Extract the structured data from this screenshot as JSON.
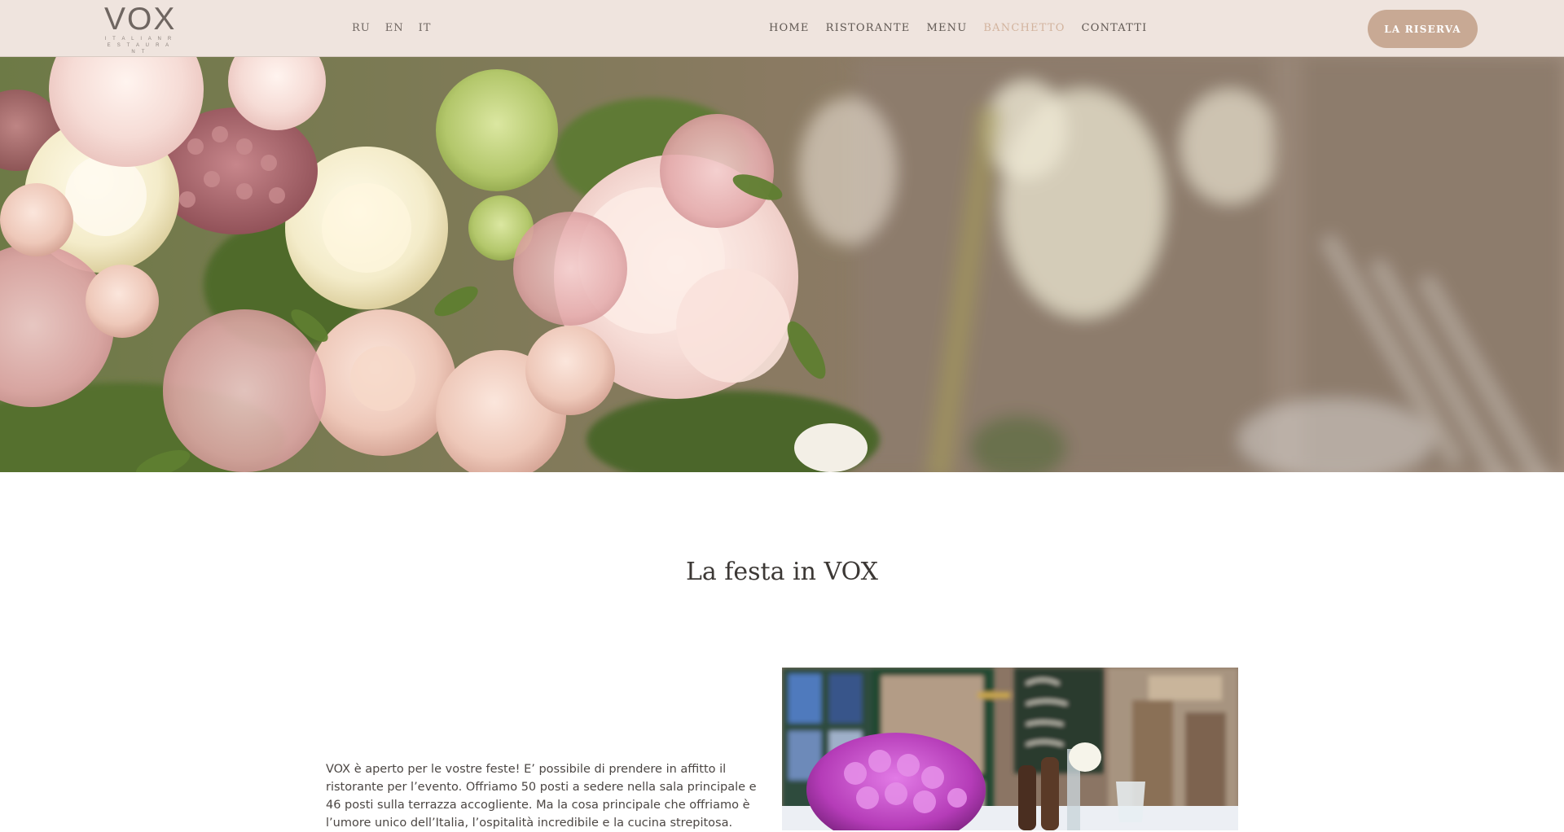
{
  "brand": {
    "logo_main": "VOX",
    "logo_sub": "I T A L I A N   R E S T A U R A N T"
  },
  "languages": [
    "RU",
    "EN",
    "IT"
  ],
  "nav": {
    "items": [
      {
        "label": "HOME",
        "active": false
      },
      {
        "label": "RISTORANTE",
        "active": false
      },
      {
        "label": "MENU",
        "active": false
      },
      {
        "label": "BANCHETTO",
        "active": true
      },
      {
        "label": "CONTATTI",
        "active": false
      }
    ]
  },
  "header": {
    "reserve_label": "LA RISERVA"
  },
  "content": {
    "title": "La festa in VOX",
    "intro": "VOX è aperto per le vostre feste! E’ possibile di prendere in affitto il ristorante per l’evento. Offriamo 50 posti a sedere nella sala principale e 46 posti sulla terrazza accogliente. Ma la cosa principale che offriamo è l’umore unico dell’Italia, l’ospitalità incredibile e la cucina strepitosa."
  },
  "colors": {
    "header_bg": "#efe4de",
    "accent": "#c8a994",
    "active_nav": "#d2b39d",
    "text": "#3c3835"
  },
  "icons": {
    "hero": "flower-bouquet-photo",
    "photo": "restaurant-table-flowers-photo"
  }
}
